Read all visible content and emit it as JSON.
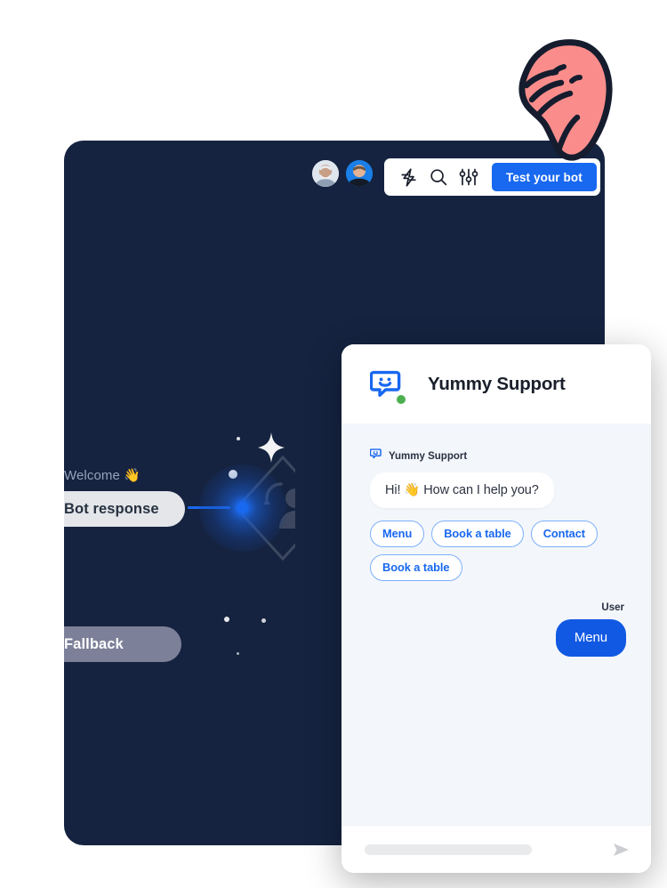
{
  "colors": {
    "panel_bg": "#152340",
    "accent_blue": "#1868f0",
    "user_bubble": "#1159e3",
    "widget_bg": "#f3f6fb",
    "hand_pink": "#fa8d8b",
    "online_green": "#4caf50",
    "fallback_gray": "#7c8099",
    "bot_node_gray": "#e4e6ea"
  },
  "toolbar": {
    "avatars": [
      {
        "name": "avatar-user-1",
        "bg": "#dfe6ee"
      },
      {
        "name": "avatar-user-2",
        "bg": "#1a7fe8"
      }
    ],
    "icons": [
      {
        "name": "lightning-icon",
        "label": "Automations"
      },
      {
        "name": "search-icon",
        "label": "Search"
      },
      {
        "name": "sliders-icon",
        "label": "Settings"
      }
    ],
    "test_bot_label": "Test your bot"
  },
  "flow": {
    "welcome_label": "Welcome 👋",
    "bot_response_label": "Bot response",
    "fallback_label": "Fallback"
  },
  "chat": {
    "title": "Yummy Support",
    "logo_icon": "chatbot-logo-icon",
    "status": "online",
    "bot_name": "Yummy Support",
    "bot_message": "Hi! 👋 How can I help you?",
    "quick_replies": [
      "Menu",
      "Book a table",
      "Contact",
      "Book a table"
    ],
    "user_name": "User",
    "user_message": "Menu",
    "input_placeholder": "",
    "send_icon": "send-arrow-icon"
  },
  "cursor": {
    "icon": "pointing-hand-icon"
  }
}
